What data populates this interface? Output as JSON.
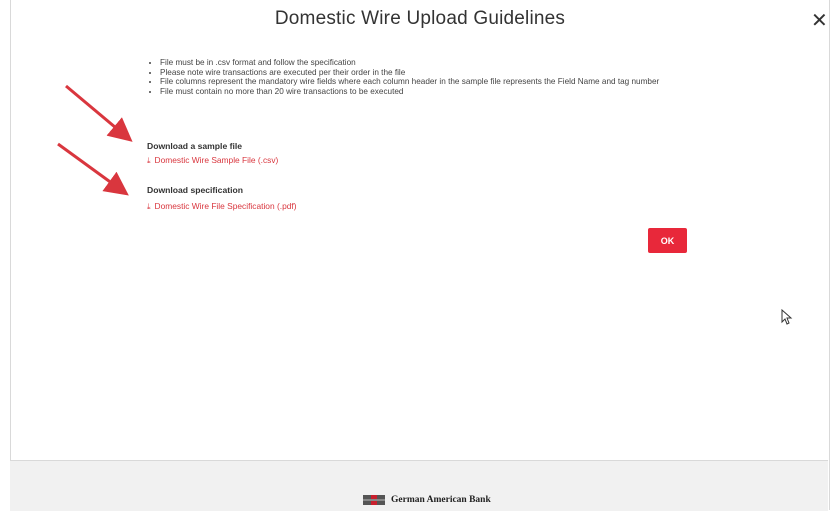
{
  "dialog": {
    "title": "Domestic Wire Upload Guidelines",
    "close_icon": "close-icon"
  },
  "guidelines": [
    "File must be in .csv format and follow the specification",
    "Please note wire transactions are executed per their order in the file",
    "File columns represent the mandatory wire fields where each column header in the sample file represents the Field Name and tag number",
    "File must contain no more than 20 wire transactions to be executed"
  ],
  "sample": {
    "heading": "Download a sample file",
    "link": "Domestic Wire Sample File (.csv)",
    "icon": "download-icon"
  },
  "spec": {
    "heading": "Download specification",
    "link": "Domestic Wire File Specification (.pdf)",
    "icon": "download-icon"
  },
  "ok_label": "OK",
  "footer": {
    "brand": "German American Bank"
  },
  "colors": {
    "accent": "#e8283a",
    "link": "#d9363e",
    "annotation_arrow": "#d9363e"
  }
}
